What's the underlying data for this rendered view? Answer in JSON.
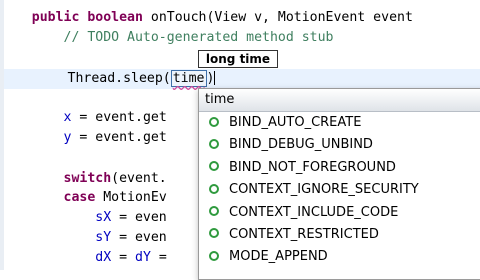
{
  "editor": {
    "lines": [
      {
        "parts": [
          {
            "text": "    ",
            "cls": ""
          },
          {
            "text": "public",
            "cls": "kw"
          },
          {
            "text": " ",
            "cls": ""
          },
          {
            "text": "boolean",
            "cls": "kw"
          },
          {
            "text": " onTouch(View v, MotionEvent event",
            "cls": ""
          }
        ]
      },
      {
        "parts": [
          {
            "text": "        ",
            "cls": ""
          },
          {
            "text": "// TODO Auto-generated method stub",
            "cls": "cm"
          }
        ]
      },
      {
        "parts": []
      },
      {
        "parts": [
          {
            "text": "        Thread.sleep(",
            "cls": ""
          },
          {
            "text": "time",
            "cls": "param"
          },
          {
            "text": ")",
            "cls": ""
          }
        ],
        "current": true
      },
      {
        "parts": []
      },
      {
        "parts": [
          {
            "text": "        ",
            "cls": ""
          },
          {
            "text": "x",
            "cls": "fd"
          },
          {
            "text": " = event.get",
            "cls": ""
          }
        ]
      },
      {
        "parts": [
          {
            "text": "        ",
            "cls": ""
          },
          {
            "text": "y",
            "cls": "fd"
          },
          {
            "text": " = event.get",
            "cls": ""
          }
        ]
      },
      {
        "parts": []
      },
      {
        "parts": [
          {
            "text": "        ",
            "cls": ""
          },
          {
            "text": "switch",
            "cls": "kw"
          },
          {
            "text": "(event.",
            "cls": ""
          }
        ]
      },
      {
        "parts": [
          {
            "text": "        ",
            "cls": ""
          },
          {
            "text": "case",
            "cls": "kw"
          },
          {
            "text": " MotionEv",
            "cls": ""
          }
        ]
      },
      {
        "parts": [
          {
            "text": "            ",
            "cls": ""
          },
          {
            "text": "sX",
            "cls": "fd"
          },
          {
            "text": " = even",
            "cls": ""
          }
        ]
      },
      {
        "parts": [
          {
            "text": "            ",
            "cls": ""
          },
          {
            "text": "sY",
            "cls": "fd"
          },
          {
            "text": " = even",
            "cls": ""
          }
        ]
      },
      {
        "parts": [
          {
            "text": "            ",
            "cls": ""
          },
          {
            "text": "dX",
            "cls": "fd"
          },
          {
            "text": " = ",
            "cls": ""
          },
          {
            "text": "dY",
            "cls": "fd"
          },
          {
            "text": " = ",
            "cls": ""
          }
        ]
      }
    ]
  },
  "parameter_hint": {
    "text": "long time"
  },
  "completion": {
    "header": "time",
    "items": [
      {
        "label": "BIND_AUTO_CREATE",
        "icon": "field-icon"
      },
      {
        "label": "BIND_DEBUG_UNBIND",
        "icon": "field-icon"
      },
      {
        "label": "BIND_NOT_FOREGROUND",
        "icon": "field-icon"
      },
      {
        "label": "CONTEXT_IGNORE_SECURITY",
        "icon": "field-icon"
      },
      {
        "label": "CONTEXT_INCLUDE_CODE",
        "icon": "field-icon"
      },
      {
        "label": "CONTEXT_RESTRICTED",
        "icon": "field-icon"
      },
      {
        "label": "MODE_APPEND",
        "icon": "field-icon"
      }
    ]
  },
  "colors": {
    "keyword": "#7f0055",
    "comment": "#3f7f5f",
    "field": "#0000c0",
    "current_line": "#e8f2fe",
    "field_icon": "#2f9a3e"
  }
}
